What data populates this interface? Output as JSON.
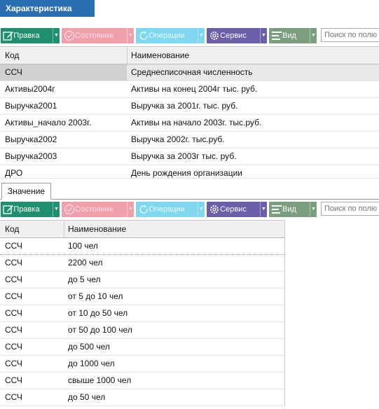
{
  "header": {
    "title": "Характеристика"
  },
  "toolbar": {
    "edit_label": "Правка",
    "state_label": "Состояние",
    "ops_label": "Операции",
    "service_label": "Сервис",
    "view_label": "Вид",
    "search_placeholder": "Поиск по полю",
    "edit_icon": "pencil-icon",
    "state_icon": "check-circle-icon",
    "ops_icon": "refresh-icon",
    "service_icon": "gear-icon",
    "view_icon": "list-icon"
  },
  "top_grid": {
    "columns": [
      "Код",
      "Наименование"
    ],
    "rows": [
      {
        "code": "ССЧ",
        "name": "Среднесписочная численность"
      },
      {
        "code": "Активы2004г",
        "name": "Активы на конец 2004г тыс. руб."
      },
      {
        "code": "Выручка2001",
        "name": "Выручка за 2001г. тыс. руб."
      },
      {
        "code": "Активы_начало 2003г.",
        "name": "Активы на начало 2003г. тыс.руб."
      },
      {
        "code": "Выручка2002",
        "name": "Выручка 2002г. тыс.руб."
      },
      {
        "code": "Выручка2003",
        "name": "Выручка за 2003г тыс. руб."
      },
      {
        "code": "ДРО",
        "name": "День рождения организации"
      }
    ]
  },
  "tab": {
    "label": "Значение"
  },
  "bottom_grid": {
    "columns": [
      "Код",
      "Наименование"
    ],
    "rows": [
      {
        "code": "ССЧ",
        "name": "100 чел"
      },
      {
        "code": "ССЧ",
        "name": "2200 чел"
      },
      {
        "code": "ССЧ",
        "name": "до 5 чел"
      },
      {
        "code": "ССЧ",
        "name": "от 5 до 10 чел"
      },
      {
        "code": "ССЧ",
        "name": "от 10 до 50 чел"
      },
      {
        "code": "ССЧ",
        "name": "от 50 до 100 чел"
      },
      {
        "code": "ССЧ",
        "name": "до 500 чел"
      },
      {
        "code": "ССЧ",
        "name": "до 1000 чел"
      },
      {
        "code": "ССЧ",
        "name": "свыше 1000 чел"
      },
      {
        "code": "ССЧ",
        "name": "до 50 чел"
      }
    ]
  },
  "colors": {
    "accent": "#2b6fb3",
    "edit": "#1f8f6d",
    "service": "#6a5fa8",
    "view": "#7a9e7e"
  }
}
